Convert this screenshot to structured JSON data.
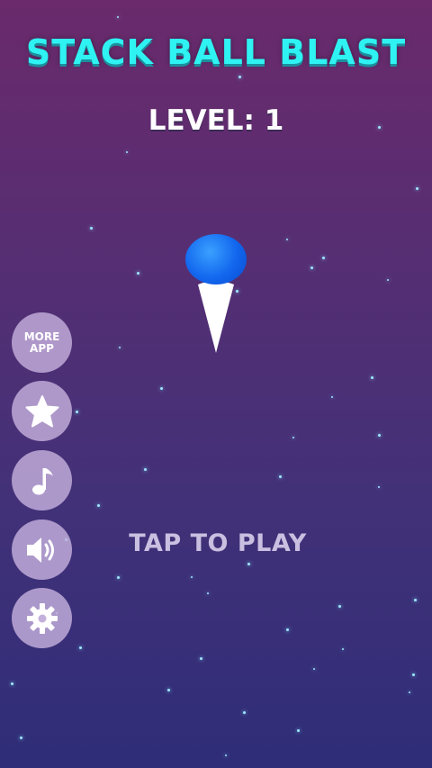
{
  "game": {
    "title": "STACK BALL BLAST",
    "level_text": "LEVEL: 1",
    "tap_prompt": "TAP TO PLAY"
  },
  "sidebar": {
    "more_app_line1": "MORE",
    "more_app_line2": "APP",
    "buttons": [
      {
        "name": "more-app-button",
        "icon": "more-app"
      },
      {
        "name": "rate-button",
        "icon": "star-icon"
      },
      {
        "name": "music-button",
        "icon": "music-note-icon"
      },
      {
        "name": "sound-button",
        "icon": "speaker-icon"
      },
      {
        "name": "settings-button",
        "icon": "gear-icon"
      }
    ]
  },
  "colors": {
    "title": "#2ff2f2",
    "ball": "#1266ee",
    "button_bg": "#c4b0dc",
    "tap_text": "#c9bfe0"
  }
}
